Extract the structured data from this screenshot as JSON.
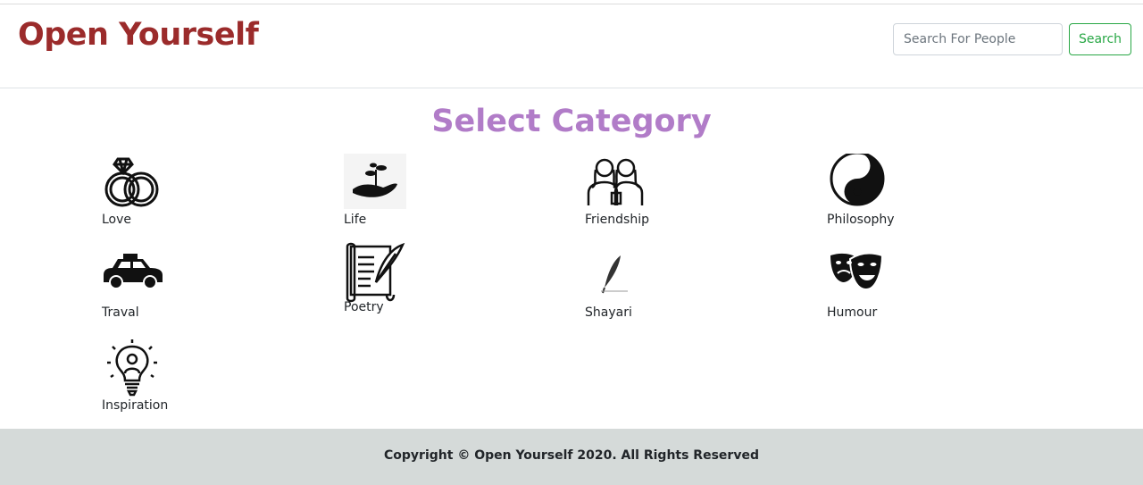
{
  "brand": "Open Yourself",
  "search": {
    "placeholder": "Search For People",
    "button_label": "Search"
  },
  "heading": "Select Category",
  "categories": [
    {
      "label": "Love",
      "icon": "rings-icon"
    },
    {
      "label": "Life",
      "icon": "plant-in-hand-icon"
    },
    {
      "label": "Friendship",
      "icon": "friends-icon"
    },
    {
      "label": "Philosophy",
      "icon": "yin-yang-icon"
    },
    {
      "label": "Traval",
      "icon": "taxi-icon"
    },
    {
      "label": "Poetry",
      "icon": "scroll-quill-icon"
    },
    {
      "label": "Shayari",
      "icon": "quill-icon"
    },
    {
      "label": "Humour",
      "icon": "theater-masks-icon"
    },
    {
      "label": "Inspiration",
      "icon": "idea-bulb-icon"
    }
  ],
  "footer": {
    "copyright": "Copyright © Open Yourself 2020. All Rights Reserved"
  },
  "colors": {
    "brand": "#9b2b2b",
    "heading": "#b17cc8",
    "search_button": "#28a745",
    "footer_bg": "#d5dad9"
  }
}
